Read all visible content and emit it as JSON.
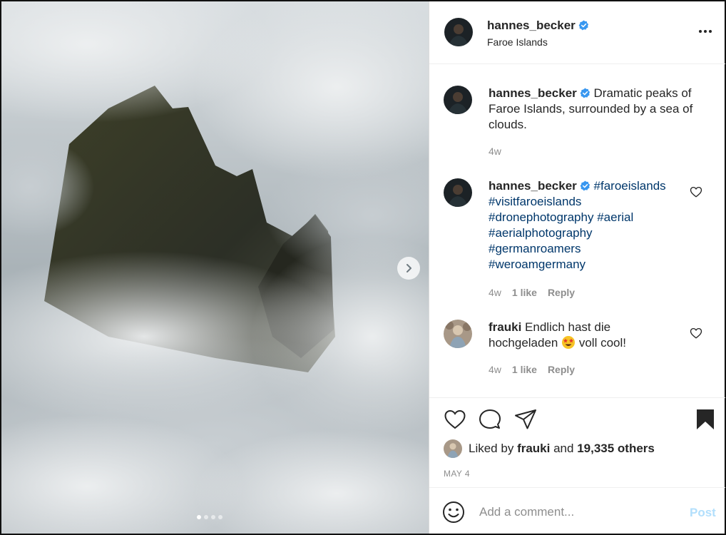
{
  "header": {
    "username": "hannes_becker",
    "location": "Faroe Islands"
  },
  "comments": [
    {
      "username": "hannes_becker",
      "text": "Dramatic peaks of Faroe Islands, surrounded by a sea of clouds.",
      "time": "4w"
    },
    {
      "username": "hannes_becker",
      "tags": [
        "#faroeislands",
        "#visitfaroeislands",
        "#dronephotography",
        "#aerial",
        "#aerialphotography",
        "#germanroamers",
        "#weroamgermany"
      ],
      "time": "4w",
      "likes": "1 like",
      "reply": "Reply"
    },
    {
      "username": "frauki",
      "text_before": "Endlich hast die hochgeladen",
      "text_after": "voll cool!",
      "time": "4w",
      "likes": "1 like",
      "reply": "Reply"
    }
  ],
  "likes": {
    "prefix": "Liked by",
    "user": "frauki",
    "and": "and",
    "others": "19,335 others"
  },
  "date": "MAY 4",
  "add_comment": {
    "placeholder": "Add a comment...",
    "post_label": "Post"
  },
  "carousel": {
    "current": 1,
    "total": 4
  },
  "colors": {
    "verified": "#3897f0",
    "hashtag": "#00376b",
    "muted": "#8e8e8e",
    "post_disabled": "#b2dffc"
  },
  "icons": {
    "more": "ellipsis-icon",
    "like": "heart-icon",
    "comment": "speech-bubble-icon",
    "share": "paper-plane-icon",
    "save": "bookmark-filled-icon",
    "emoji": "smiley-icon",
    "next": "chevron-right-icon"
  }
}
